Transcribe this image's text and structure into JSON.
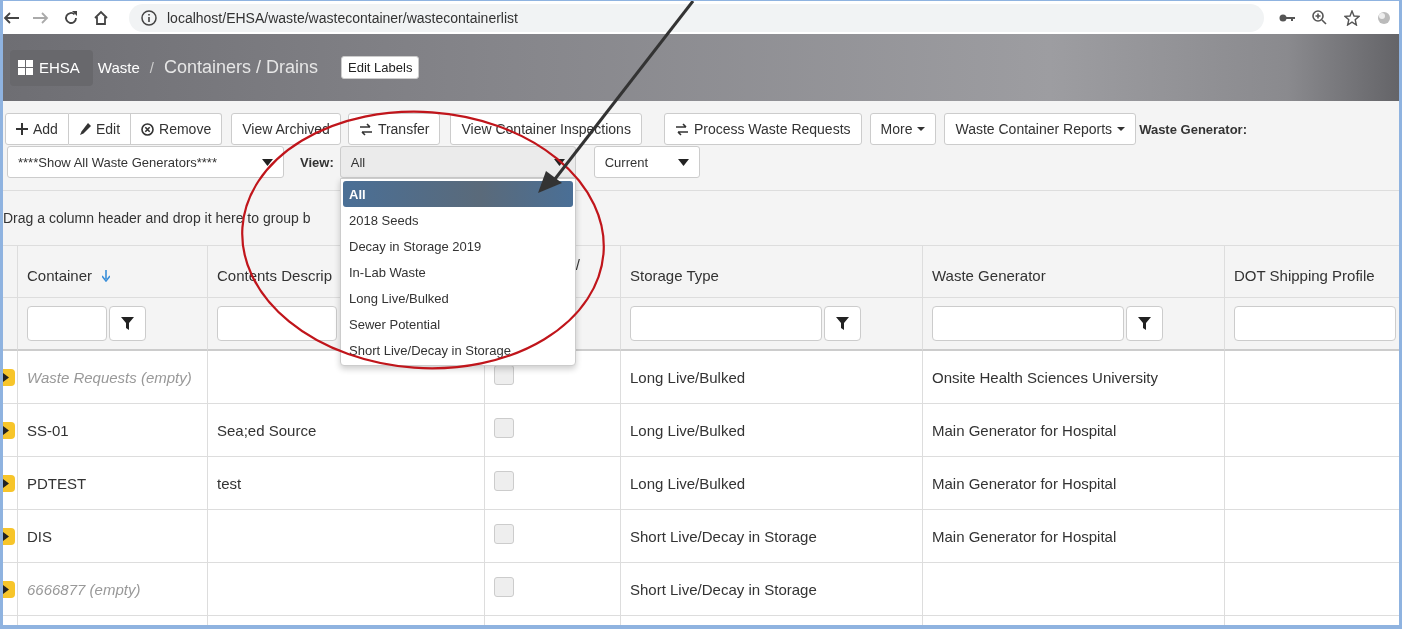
{
  "browser": {
    "url": "localhost/EHSA/waste/wastecontainer/wastecontainerlist"
  },
  "header": {
    "app": "EHSA",
    "breadcrumb": [
      "Waste",
      "/",
      "Containers / Drains"
    ],
    "edit_button": "Edit Labels"
  },
  "toolbar": {
    "buttons": [
      "Add",
      "Edit",
      "Remove",
      "View Archived",
      "Transfer",
      "View Container Inspections",
      "Process Waste Requests",
      "More",
      "Waste Container Reports"
    ],
    "generator_label": "Waste Generator:",
    "generator_select": "****Show All Waste Generators****",
    "view_label": "View:",
    "view": {
      "value": "All",
      "expanded": true,
      "options": [
        {
          "label": "All",
          "selected": true
        },
        {
          "label": "2018 Seeds",
          "selected": false
        },
        {
          "label": "Decay in Storage 2019",
          "selected": false
        },
        {
          "label": "In-Lab Waste",
          "selected": false
        },
        {
          "label": "Long Live/Bulked",
          "selected": false
        },
        {
          "label": "Sewer Potential",
          "selected": false
        },
        {
          "label": "Short Live/Decay in Storage",
          "selected": false
        }
      ]
    },
    "status_select": "Current"
  },
  "group_panel": "Drag a column header and drop it here to group b",
  "columns": [
    {
      "label": "Container",
      "sorted": true
    },
    {
      "label": "Contents Descrip",
      "sorted": false
    },
    {
      "label": "/",
      "sorted": false
    },
    {
      "label": "Storage Type",
      "sorted": false
    },
    {
      "label": "Waste Generator",
      "sorted": false
    },
    {
      "label": "DOT Shipping Profile",
      "sorted": false
    }
  ],
  "rows": [
    {
      "container": "Waste Requests (empty)",
      "empty": true,
      "contents": "",
      "checked": false,
      "storage": "Long Live/Bulked",
      "generator": "Onsite Health Sciences University"
    },
    {
      "container": "SS-01",
      "empty": false,
      "contents": "Sea;ed Source",
      "checked": false,
      "storage": "Long Live/Bulked",
      "generator": "Main Generator for Hospital"
    },
    {
      "container": "PDTEST",
      "empty": false,
      "contents": "test",
      "checked": false,
      "storage": "Long Live/Bulked",
      "generator": "Main Generator for Hospital"
    },
    {
      "container": "DIS",
      "empty": false,
      "contents": "",
      "checked": false,
      "storage": "Short Live/Decay in Storage",
      "generator": "Main Generator for Hospital"
    },
    {
      "container": "6666877 (empty)",
      "empty": true,
      "contents": "",
      "checked": false,
      "storage": "Short Live/Decay in Storage",
      "generator": ""
    }
  ],
  "annotations": [
    {
      "kind": "ellipse"
    },
    {
      "kind": "arrow"
    }
  ]
}
